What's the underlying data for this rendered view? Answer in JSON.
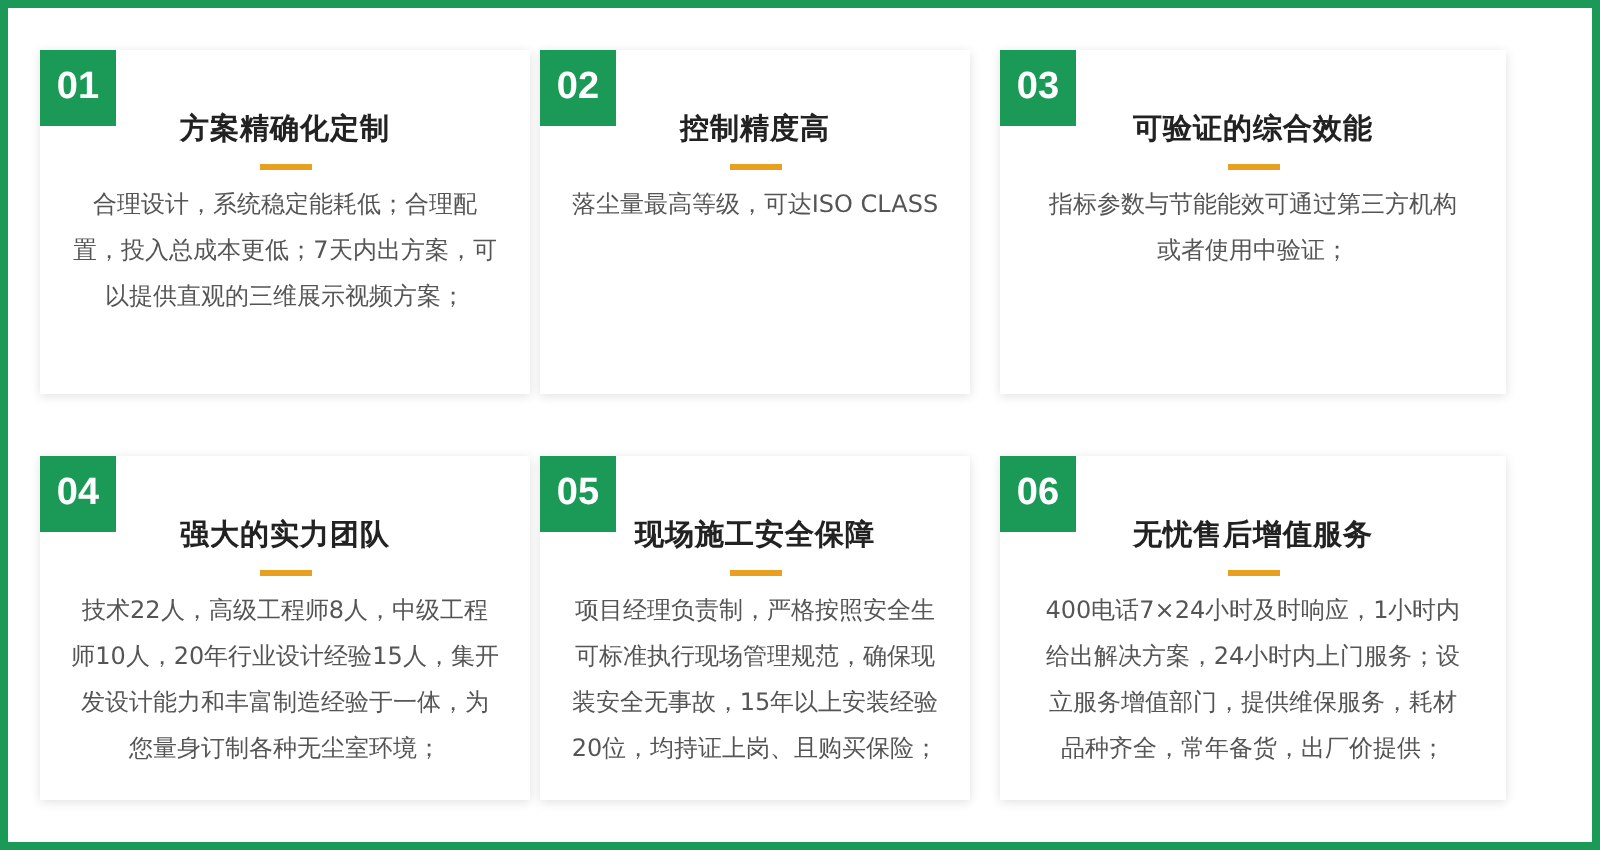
{
  "cards": [
    {
      "number": "01",
      "title": "方案精确化定制",
      "lines": [
        "合理设计，系统稳定能耗低；合理配",
        "置，投入总成本更低；7天内出方案，可",
        "以提供直观的三维展示视频方案；"
      ]
    },
    {
      "number": "02",
      "title": "控制精度高",
      "lines": [
        "落尘量最高等级，可达ISO CLASS"
      ]
    },
    {
      "number": "03",
      "title": "可验证的综合效能",
      "lines": [
        "指标参数与节能能效可通过第三方机构",
        "或者使用中验证；"
      ]
    },
    {
      "number": "04",
      "title": "强大的实力团队",
      "lines": [
        "技术22人，高级工程师8人，中级工程",
        "师10人，20年行业设计经验15人，集开",
        "发设计能力和丰富制造经验于一体，为",
        "您量身订制各种无尘室环境；"
      ]
    },
    {
      "number": "05",
      "title": "现场施工安全保障",
      "lines": [
        "项目经理负责制，严格按照安全生",
        "可标准执行现场管理规范，确保现",
        "装安全无事故，15年以上安装经验",
        "20位，均持证上岗、且购买保险；"
      ]
    },
    {
      "number": "06",
      "title": "无忧售后增值服务",
      "lines": [
        "400电话7×24小时及时响应，1小时内",
        "给出解决方案，24小时内上门服务；设",
        "立服务增值部门，提供维保服务，耗材",
        "品种齐全，常年备货，出厂价提供；"
      ]
    }
  ]
}
